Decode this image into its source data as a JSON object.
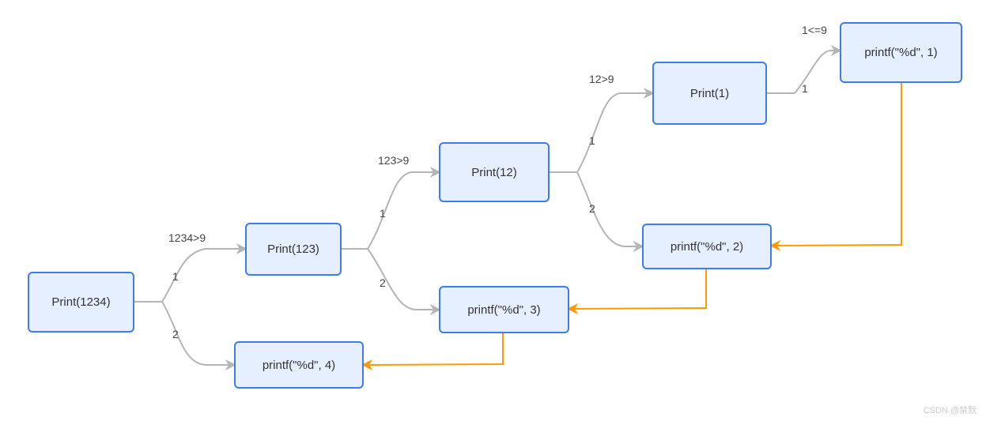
{
  "diagram": {
    "nodes": {
      "n1": "Print(1234)",
      "n2": "Print(123)",
      "n3": "Print(12)",
      "n4": "Print(1)",
      "p1": "printf(\"%d\", 1)",
      "p2": "printf(\"%d\", 2)",
      "p3": "printf(\"%d\", 3)",
      "p4": "printf(\"%d\", 4)"
    },
    "labels": {
      "cond1": "1234>9",
      "cond2": "123>9",
      "cond3": "12>9",
      "cond4": "1<=9",
      "b1a": "1",
      "b1b": "2",
      "b2a": "1",
      "b2b": "2",
      "b3a": "1",
      "b3b": "2",
      "b4": "1"
    },
    "watermark": "CSDN @禁默"
  }
}
